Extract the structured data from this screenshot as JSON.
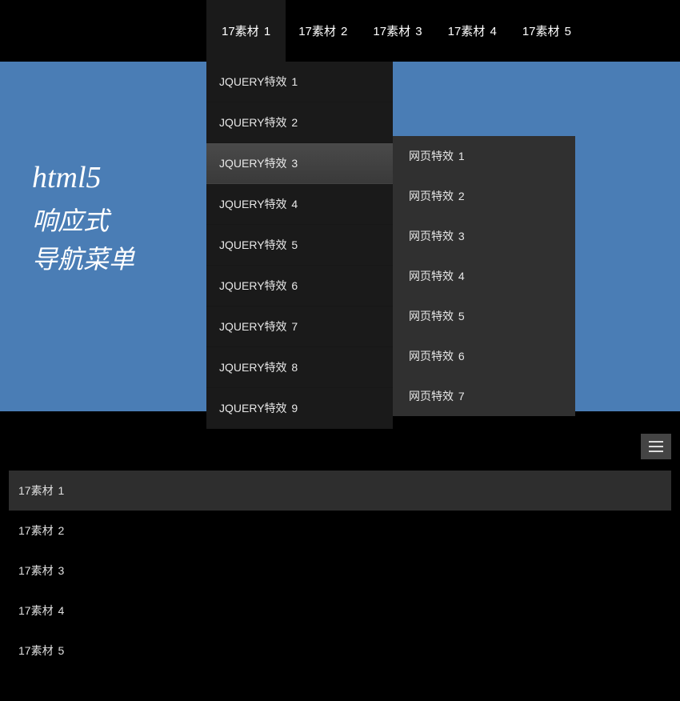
{
  "hero": {
    "title_en": "html5",
    "title_cn1": "响应式",
    "title_cn2": "导航菜单"
  },
  "topNav": {
    "items": [
      {
        "label": "17素材 1"
      },
      {
        "label": "17素材 2"
      },
      {
        "label": "17素材 3"
      },
      {
        "label": "17素材 4"
      },
      {
        "label": "17素材 5"
      }
    ]
  },
  "dropdown1": {
    "items": [
      {
        "label": "JQUERY特效 1"
      },
      {
        "label": "JQUERY特效 2"
      },
      {
        "label": "JQUERY特效 3"
      },
      {
        "label": "JQUERY特效 4"
      },
      {
        "label": "JQUERY特效 5"
      },
      {
        "label": "JQUERY特效 6"
      },
      {
        "label": "JQUERY特效 7"
      },
      {
        "label": "JQUERY特效 8"
      },
      {
        "label": "JQUERY特效 9"
      }
    ]
  },
  "dropdown2": {
    "items": [
      {
        "label": "网页特效 1"
      },
      {
        "label": "网页特效 2"
      },
      {
        "label": "网页特效 3"
      },
      {
        "label": "网页特效 4"
      },
      {
        "label": "网页特效 5"
      },
      {
        "label": "网页特效 6"
      },
      {
        "label": "网页特效 7"
      }
    ]
  },
  "mobileNav": {
    "items": [
      {
        "label": "17素材 1"
      },
      {
        "label": "17素材 2"
      },
      {
        "label": "17素材 3"
      },
      {
        "label": "17素材 4"
      },
      {
        "label": "17素材 5"
      }
    ]
  }
}
